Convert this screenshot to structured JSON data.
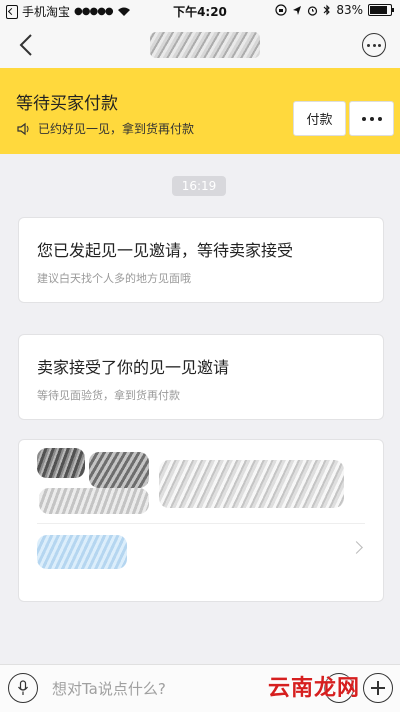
{
  "status_bar": {
    "carrier": "手机淘宝",
    "signal": "●●●●●",
    "time": "下午4:20",
    "battery": "83%"
  },
  "header": {
    "more_icon": "more-circle-icon"
  },
  "banner": {
    "title": "等待买家付款",
    "notice": "已约好见一见，拿到货再付款",
    "pay_label": "付款",
    "menu_icon": "ellipsis-icon"
  },
  "timestamp": "16:19",
  "messages": [
    {
      "title": "您已发起见一见邀请，等待卖家接受",
      "subtitle": "建议白天找个人多的地方见面哦"
    },
    {
      "title": "卖家接受了你的见一见邀请",
      "subtitle": "等待见面验货，拿到货再付款"
    }
  ],
  "input": {
    "placeholder": "想对Ta说点什么?"
  },
  "watermark": "云南龙网",
  "colors": {
    "banner": "#ffd93d",
    "background": "#f0f0f3"
  }
}
